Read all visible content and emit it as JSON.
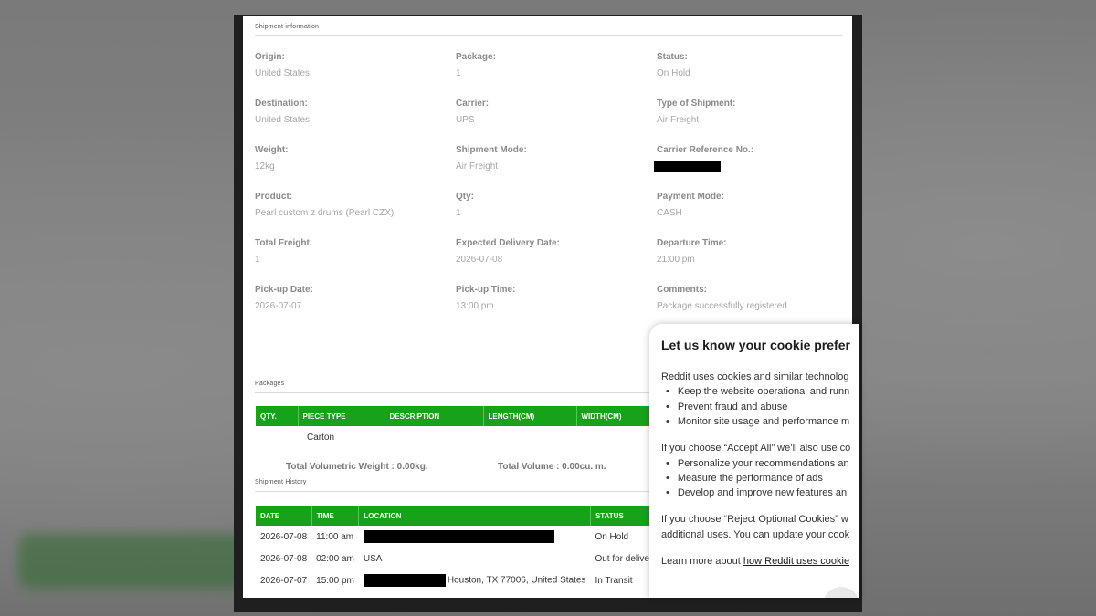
{
  "shipment_info": {
    "section_title": "Shipment information",
    "fields": [
      {
        "label": "Origin:",
        "value": "United States"
      },
      {
        "label": "Package:",
        "value": "1"
      },
      {
        "label": "Status:",
        "value": "On Hold"
      },
      {
        "label": "Destination:",
        "value": "United States"
      },
      {
        "label": "Carrier:",
        "value": "UPS"
      },
      {
        "label": "Type of Shipment:",
        "value": "Air Freight"
      },
      {
        "label": "Weight:",
        "value": "12kg"
      },
      {
        "label": "Shipment Mode:",
        "value": "Air Freight"
      },
      {
        "label": "Carrier Reference No.:",
        "value": ""
      },
      {
        "label": "Product:",
        "value": "Pearl custom z drums (Pearl CZX)"
      },
      {
        "label": "Qty:",
        "value": "1"
      },
      {
        "label": "Payment Mode:",
        "value": "CASH"
      },
      {
        "label": "Total Freight:",
        "value": "1"
      },
      {
        "label": "Expected Delivery Date:",
        "value": "2026-07-08"
      },
      {
        "label": "Departure Time:",
        "value": "21:00 pm"
      },
      {
        "label": "Pick-up Date:",
        "value": "2026-07-07"
      },
      {
        "label": "Pick-up Time:",
        "value": "13:00 pm"
      },
      {
        "label": "Comments:",
        "value": "Package successfully registered"
      }
    ]
  },
  "packages": {
    "section_title": "Packages",
    "headers": [
      "QTY.",
      "PIECE TYPE",
      "DESCRIPTION",
      "LENGTH(CM)",
      "WIDTH(CM)"
    ],
    "rows": [
      [
        "",
        "Carton",
        "",
        "",
        ""
      ]
    ],
    "total_weight": "Total Volumetric Weight : 0.00kg.",
    "total_volume": "Total Volume : 0.00cu. m."
  },
  "history": {
    "section_title": "Shipment History",
    "headers": [
      "DATE",
      "TIME",
      "LOCATION",
      "STATUS"
    ],
    "rows": [
      {
        "date": "2026-07-08",
        "time": "11:00 am",
        "location": "",
        "status": "On Hold"
      },
      {
        "date": "2026-07-08",
        "time": "02:00 am",
        "location": "USA",
        "status": "Out for delivery"
      },
      {
        "date": "2026-07-07",
        "time": "15:00 pm",
        "location": "Houston, TX 77006, United States",
        "status": "In Transit"
      }
    ]
  },
  "cookie_banner": {
    "title": "Let us know your cookie prefer",
    "intro": "Reddit uses cookies and similar technolog",
    "bullets_1": [
      "Keep the website operational and runn",
      "Prevent fraud and abuse",
      "Monitor site usage and performance m"
    ],
    "accept_text": "If you choose “Accept All” we’ll also use co",
    "bullets_2": [
      "Personalize your recommendations an",
      "Measure the performance of ads",
      "Develop and improve new features an"
    ],
    "reject_line_1": "If you choose “Reject Optional Cookies” w",
    "reject_line_2": "additional uses. You can update your cook",
    "learn_prefix": "Learn more about ",
    "learn_link": "how Reddit uses cookie"
  },
  "colors": {
    "table_header": "#16a31a",
    "redaction": "#000000"
  }
}
